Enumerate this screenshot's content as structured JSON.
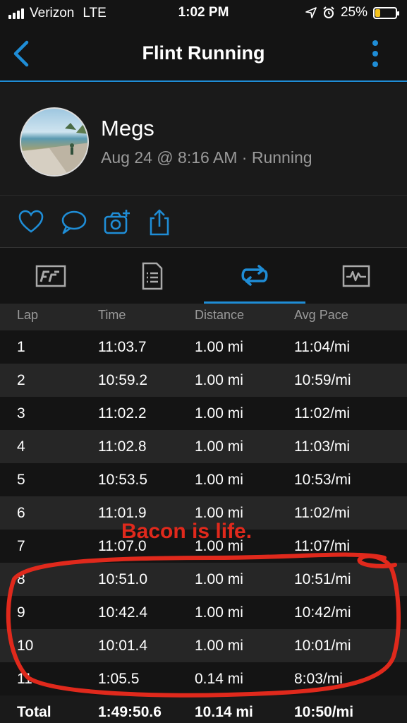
{
  "status": {
    "carrier": "Verizon",
    "network": "LTE",
    "time": "1:02 PM",
    "battery": "25%",
    "battery_level": 0.25
  },
  "nav": {
    "title": "Flint Running",
    "back_icon": "chevron-left-icon",
    "more_icon": "vertical-dots-icon"
  },
  "profile": {
    "name": "Megs",
    "meta": "Aug 24 @ 8:16 AM · Running"
  },
  "actions": [
    "like-icon",
    "comment-icon",
    "add-photo-icon",
    "share-icon"
  ],
  "tabs": [
    {
      "icon": "stats-icon",
      "active": false
    },
    {
      "icon": "details-icon",
      "active": false
    },
    {
      "icon": "laps-icon",
      "active": true
    },
    {
      "icon": "charts-icon",
      "active": false
    }
  ],
  "laps": {
    "headers": {
      "lap": "Lap",
      "time": "Time",
      "distance": "Distance",
      "pace": "Avg Pace"
    },
    "rows": [
      {
        "lap": "1",
        "time": "11:03.7",
        "distance": "1.00 mi",
        "pace": "11:04/mi"
      },
      {
        "lap": "2",
        "time": "10:59.2",
        "distance": "1.00 mi",
        "pace": "10:59/mi"
      },
      {
        "lap": "3",
        "time": "11:02.2",
        "distance": "1.00 mi",
        "pace": "11:02/mi"
      },
      {
        "lap": "4",
        "time": "11:02.8",
        "distance": "1.00 mi",
        "pace": "11:03/mi"
      },
      {
        "lap": "5",
        "time": "10:53.5",
        "distance": "1.00 mi",
        "pace": "10:53/mi"
      },
      {
        "lap": "6",
        "time": "11:01.9",
        "distance": "1.00 mi",
        "pace": "11:02/mi"
      },
      {
        "lap": "7",
        "time": "11:07.0",
        "distance": "1.00 mi",
        "pace": "11:07/mi"
      },
      {
        "lap": "8",
        "time": "10:51.0",
        "distance": "1.00 mi",
        "pace": "10:51/mi"
      },
      {
        "lap": "9",
        "time": "10:42.4",
        "distance": "1.00 mi",
        "pace": "10:42/mi"
      },
      {
        "lap": "10",
        "time": "10:01.4",
        "distance": "1.00 mi",
        "pace": "10:01/mi"
      },
      {
        "lap": "11",
        "time": "1:05.5",
        "distance": "0.14 mi",
        "pace": "8:03/mi"
      }
    ],
    "total": {
      "lap": "Total",
      "time": "1:49:50.6",
      "distance": "10.14 mi",
      "pace": "10:50/mi"
    }
  },
  "annotation": {
    "text": "Bacon is life.",
    "color": "#e0291c"
  },
  "colors": {
    "accent": "#1f8dd6",
    "background": "#141414",
    "row_alt": "#262626",
    "annotation": "#e0291c"
  }
}
